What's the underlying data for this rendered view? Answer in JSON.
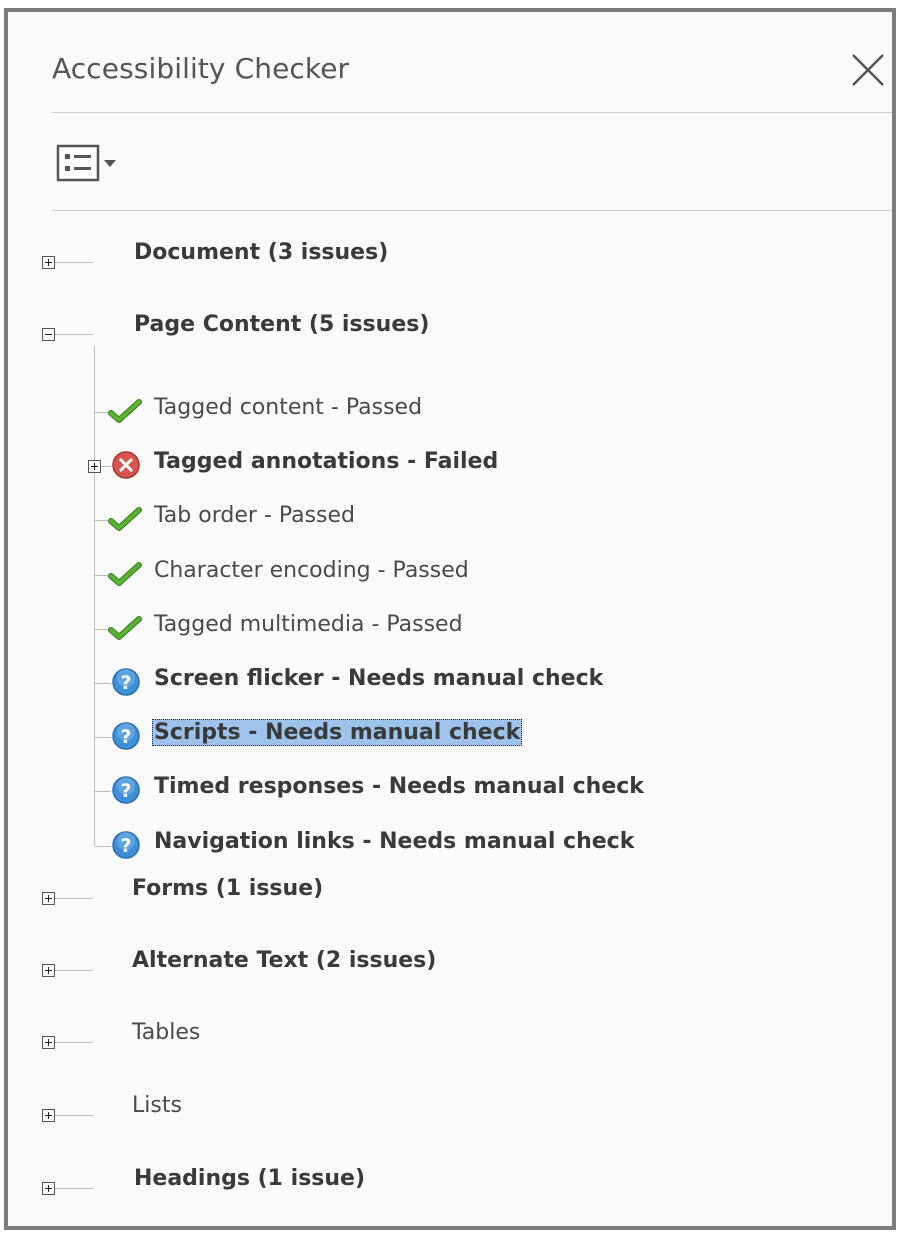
{
  "panel": {
    "title": "Accessibility Checker"
  },
  "toolbar": {
    "options_icon": "list-options-icon",
    "close_icon": "close-icon"
  },
  "categories": [
    {
      "label": "Document (3 issues)",
      "expanded": false,
      "bold": true
    },
    {
      "label": "Page Content (5 issues)",
      "expanded": true,
      "bold": true
    },
    {
      "label": "Forms (1 issue)",
      "expanded": false,
      "bold": true
    },
    {
      "label": "Alternate Text (2 issues)",
      "expanded": false,
      "bold": true
    },
    {
      "label": "Tables",
      "expanded": false,
      "bold": false
    },
    {
      "label": "Lists",
      "expanded": false,
      "bold": false
    },
    {
      "label": "Headings (1 issue)",
      "expanded": false,
      "bold": true
    }
  ],
  "page_content_items": [
    {
      "label": "Tagged content - Passed",
      "status": "passed",
      "icon": "check-icon"
    },
    {
      "label": "Tagged annotations - Failed",
      "status": "failed",
      "icon": "error-icon"
    },
    {
      "label": "Tab order - Passed",
      "status": "passed",
      "icon": "check-icon"
    },
    {
      "label": "Character encoding - Passed",
      "status": "passed",
      "icon": "check-icon"
    },
    {
      "label": "Tagged multimedia - Passed",
      "status": "passed",
      "icon": "check-icon"
    },
    {
      "label": "Screen flicker - Needs manual check",
      "status": "manual",
      "icon": "question-icon"
    },
    {
      "label": "Scripts - Needs manual check",
      "status": "manual",
      "icon": "question-icon",
      "selected": true
    },
    {
      "label": "Timed responses - Needs manual check",
      "status": "manual",
      "icon": "question-icon"
    },
    {
      "label": "Navigation links - Needs manual check",
      "status": "manual",
      "icon": "question-icon"
    }
  ],
  "colors": {
    "selection": "#9ec3ea",
    "passed": "#5bb336",
    "failed": "#d9534f",
    "manual": "#3d8fd9"
  }
}
